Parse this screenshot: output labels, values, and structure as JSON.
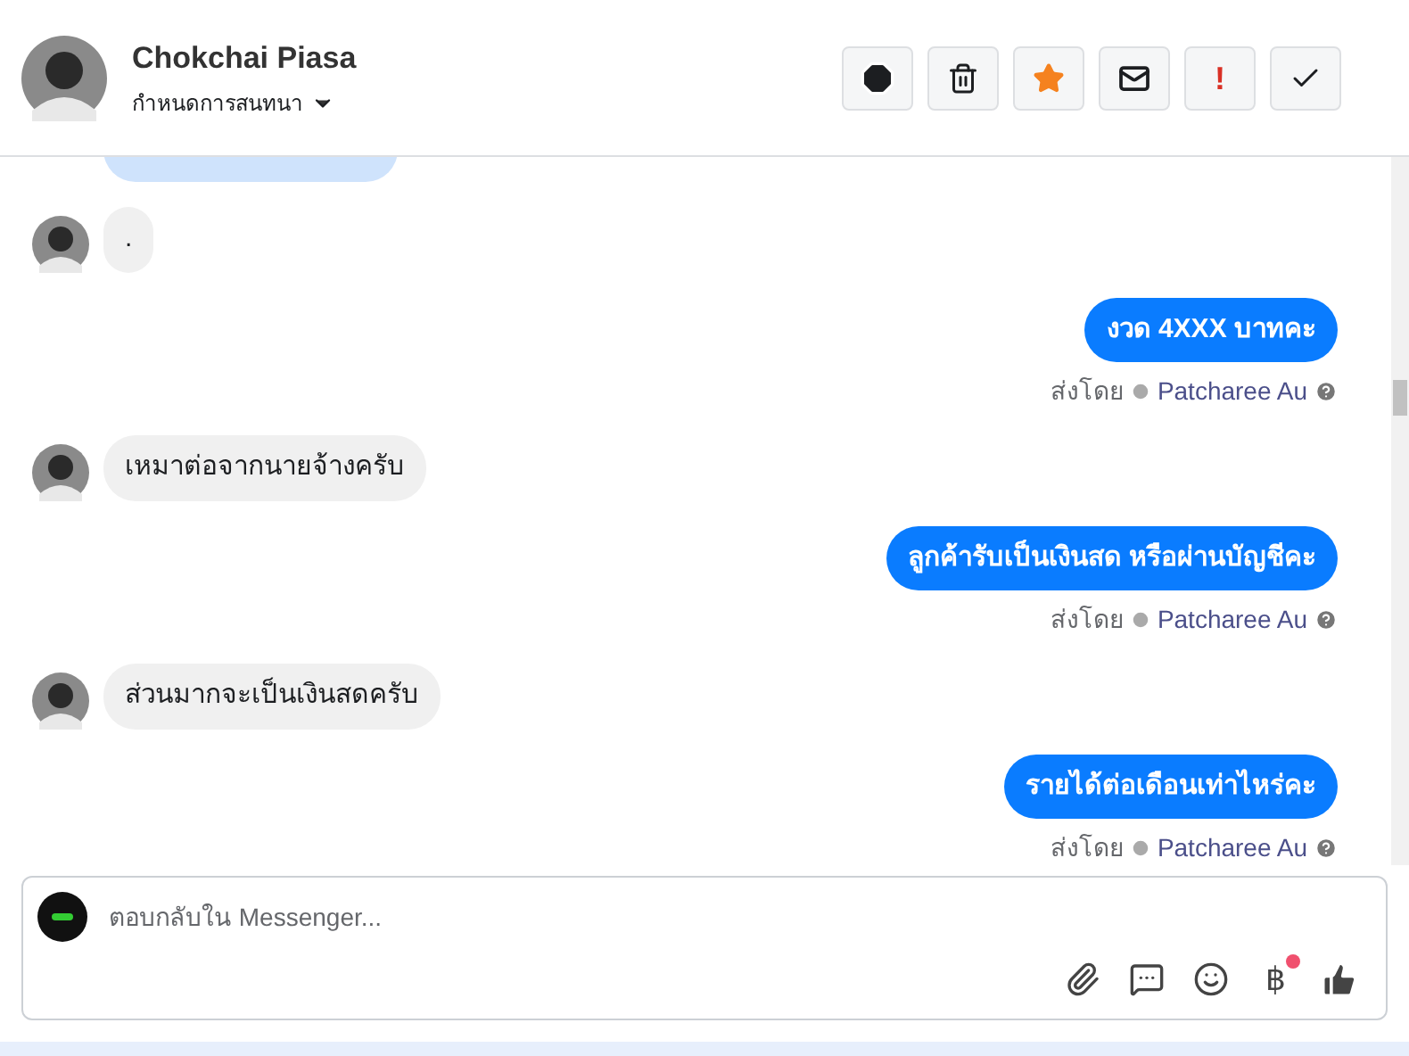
{
  "header": {
    "name": "Chokchai Piasa",
    "subtitle": "กำหนดการสนทนา",
    "actions": [
      {
        "kind": "alert"
      },
      {
        "kind": "trash"
      },
      {
        "kind": "star"
      },
      {
        "kind": "mail"
      },
      {
        "kind": "text",
        "label": "!"
      },
      {
        "kind": "check"
      }
    ]
  },
  "messages": [
    {
      "kind": "cut"
    },
    {
      "kind": "incoming",
      "text": "."
    },
    {
      "kind": "outgoing",
      "text": "งวด 4XXX บาทคะ",
      "sent_by": "ส่งโดย",
      "agent": "Patcharee Au"
    },
    {
      "kind": "incoming",
      "text": "เหมาต่อจากนายจ้างครับ"
    },
    {
      "kind": "outgoing",
      "text": "ลูกค้ารับเป็นเงินสด หรือผ่านบัญชีคะ",
      "sent_by": "ส่งโดย",
      "agent": "Patcharee Au"
    },
    {
      "kind": "incoming",
      "text": "ส่วนมากจะเป็นเงินสดครับ"
    },
    {
      "kind": "outgoing",
      "text": "รายได้ต่อเดือนเท่าไหร่คะ",
      "sent_by": "ส่งโดย",
      "agent": "Patcharee Au"
    }
  ],
  "composer": {
    "placeholder": "ตอบกลับใน Messenger...",
    "tools": [
      {
        "kind": "clip"
      },
      {
        "kind": "chat"
      },
      {
        "kind": "smile"
      },
      {
        "kind": "baht",
        "label": "฿",
        "badge": true
      },
      {
        "kind": "like"
      }
    ]
  }
}
